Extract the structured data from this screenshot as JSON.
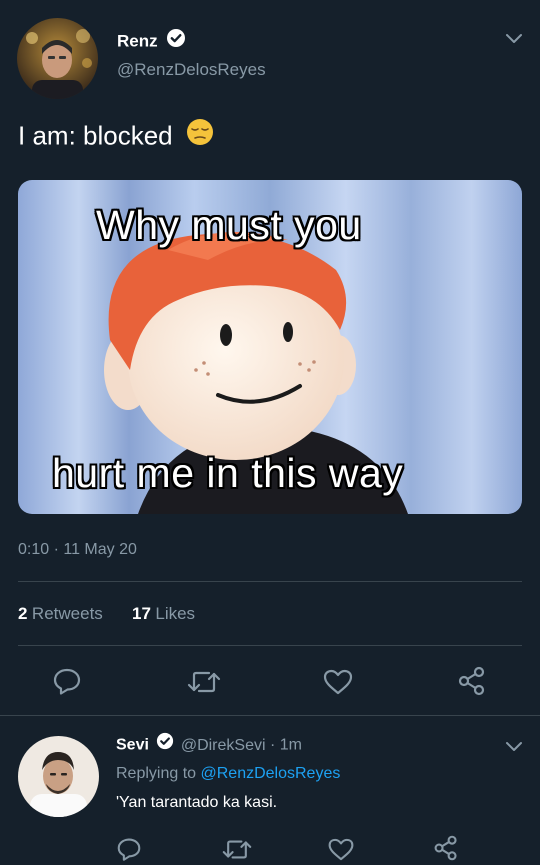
{
  "tweet": {
    "author": {
      "name": "Renz",
      "handle": "@RenzDelosReyes"
    },
    "text": "I am: blocked",
    "emoji": "pensive-face",
    "media": {
      "caption_top": "Why must you",
      "caption_bottom": "hurt me in this way"
    },
    "time": "0:10",
    "separator": "·",
    "date": "11 May 20",
    "retweets_count": "2",
    "retweets_label": "Retweets",
    "likes_count": "17",
    "likes_label": "Likes"
  },
  "reply": {
    "author": {
      "name": "Sevi",
      "handle": "@DirekSevi",
      "time": "· 1m"
    },
    "replying_to_label": "Replying to",
    "replying_to_handle": "@RenzDelosReyes",
    "text": "'Yan tarantado ka kasi."
  },
  "colors": {
    "background": "#15202b",
    "text_secondary": "#8899a6",
    "link": "#1da1f2",
    "divider": "#38444d"
  },
  "icons": [
    "chevron-down-icon",
    "verified-badge-icon",
    "reply-icon",
    "retweet-icon",
    "like-icon",
    "share-icon"
  ]
}
